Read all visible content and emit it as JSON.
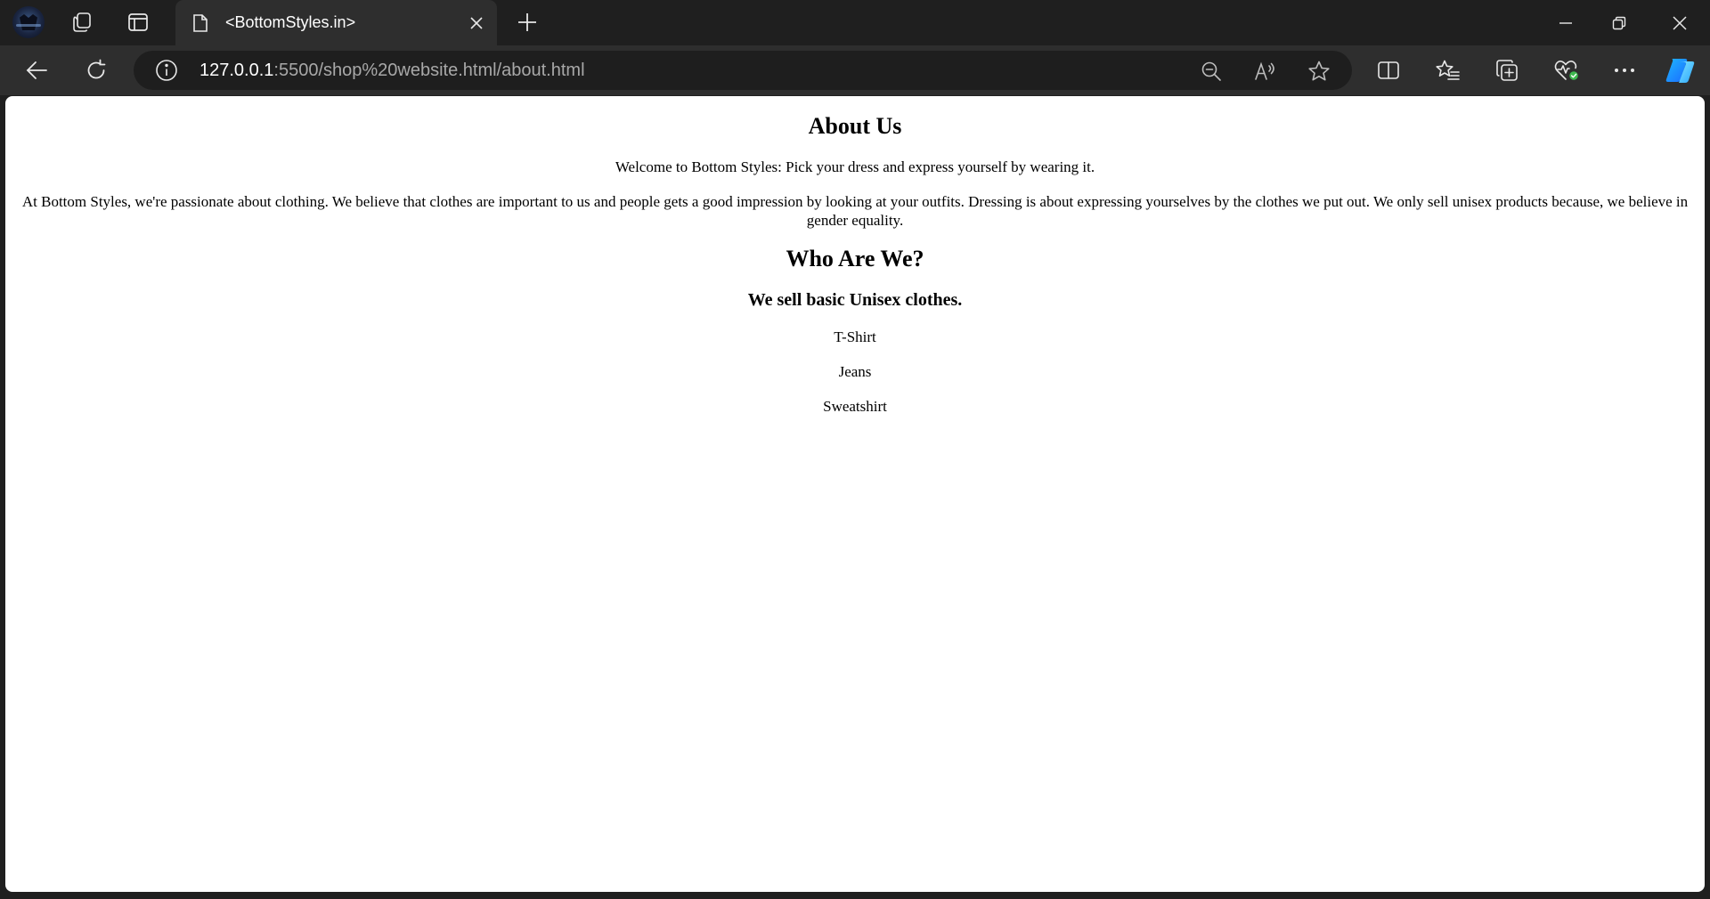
{
  "browser": {
    "tab": {
      "title": "<BottomStyles.in>"
    },
    "address": {
      "host": "127.0.0.1",
      "rest": ":5500/shop%20website.html/about.html"
    },
    "icons": {
      "profile": "profile-avatar",
      "workspaces": "workspaces-icon",
      "tab_actions": "tab-actions-icon",
      "page": "page-icon",
      "close_tab": "close-icon",
      "new_tab": "plus-icon",
      "back": "back-arrow-icon",
      "reload": "reload-icon",
      "site_info": "info-icon",
      "zoom": "zoom-out-icon",
      "read_aloud": "read-aloud-icon",
      "favorite": "star-icon",
      "split": "split-screen-icon",
      "favorites": "favorites-icon",
      "collections": "collections-icon",
      "health": "browser-essentials-icon",
      "more": "more-icon",
      "copilot": "copilot-icon"
    },
    "colors": {
      "chrome_dark": "#1f1f1f",
      "toolbar": "#2e2e2e",
      "address_bg": "#1e1e1e",
      "url_host": "#ffffff",
      "url_rest": "#a8a8a8",
      "health_badge": "#3fb950"
    }
  },
  "page": {
    "about_heading": "About Us",
    "welcome": "Welcome to Bottom Styles: Pick your dress and express yourself by wearing it.",
    "about_paragraph": "At Bottom Styles, we're passionate about clothing. We believe that clothes are important to us and people gets a good impression by looking at your outfits. Dressing is about expressing yourselves by the clothes we put out. We only sell unisex products because, we believe in gender equality.",
    "who_heading": "Who Are We?",
    "sell_heading": "We sell basic Unisex clothes.",
    "products": [
      "T-Shirt",
      "Jeans",
      "Sweatshirt"
    ]
  }
}
